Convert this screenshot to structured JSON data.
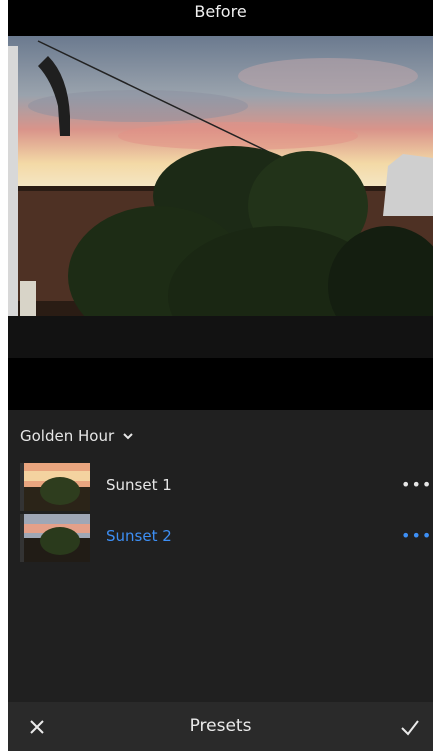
{
  "view_label": "Before",
  "preset_group": {
    "name": "Golden Hour",
    "icon": "chevron-down-icon"
  },
  "presets": [
    {
      "label": "Sunset 1",
      "selected": false,
      "more_label": "•••"
    },
    {
      "label": "Sunset 2",
      "selected": true,
      "more_label": "•••"
    }
  ],
  "bottom_bar": {
    "title": "Presets",
    "close_icon": "close-icon",
    "confirm_icon": "check-icon"
  },
  "colors": {
    "accent": "#3d8ff5",
    "panel": "#202020",
    "bar": "#2a2a2a"
  }
}
